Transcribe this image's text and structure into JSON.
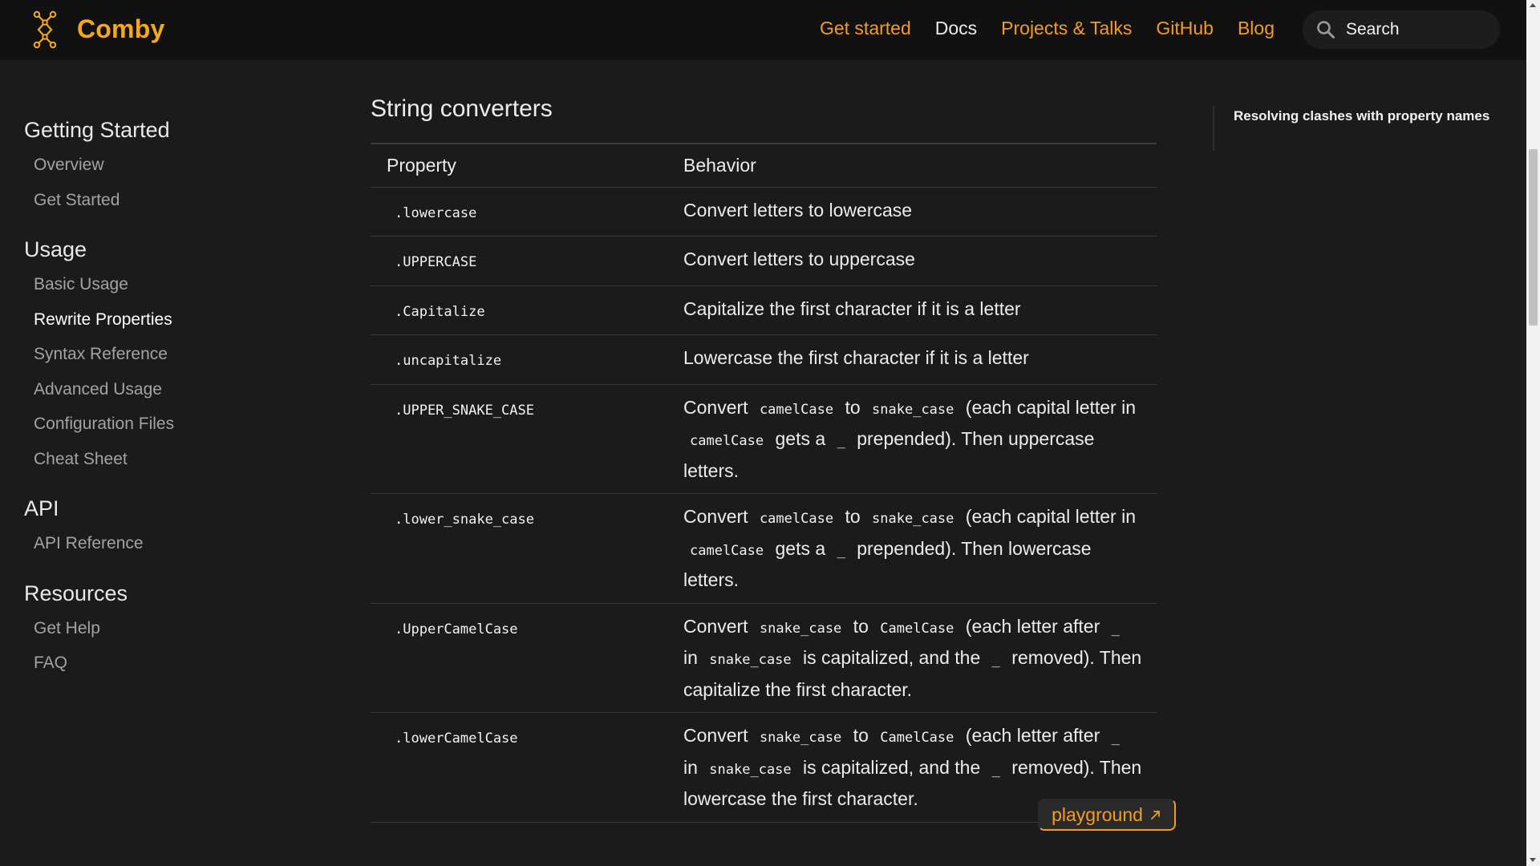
{
  "brand": {
    "name": "Comby",
    "logo_icon": "comby-logo-icon"
  },
  "nav": {
    "links": [
      {
        "label": "Get started",
        "color": "#f39c23"
      },
      {
        "label": "Docs",
        "color": "#ebebeb"
      },
      {
        "label": "Projects & Talks",
        "color": "#f39c23"
      },
      {
        "label": "GitHub",
        "color": "#f39c23"
      },
      {
        "label": "Blog",
        "color": "#f39c23"
      }
    ],
    "search": {
      "label": "Search",
      "icon": "search-icon"
    }
  },
  "sidebar": {
    "groups": [
      {
        "heading": "Getting Started",
        "items": [
          "Overview",
          "Get Started"
        ]
      },
      {
        "heading": "Usage",
        "items": [
          "Basic Usage",
          "Rewrite Properties",
          "Syntax Reference",
          "Advanced Usage",
          "Configuration Files",
          "Cheat Sheet"
        ]
      },
      {
        "heading": "API",
        "items": [
          "API Reference"
        ]
      },
      {
        "heading": "Resources",
        "items": [
          "Get Help",
          "FAQ"
        ]
      }
    ],
    "active_item": "Rewrite Properties"
  },
  "main": {
    "title": "String converters",
    "table": {
      "headers": [
        "Property",
        "Behavior"
      ],
      "rows": [
        {
          "property": ".lowercase",
          "behavior": [
            {
              "t": "Convert letters to lowercase"
            }
          ]
        },
        {
          "property": ".UPPERCASE",
          "behavior": [
            {
              "t": "Convert letters to uppercase"
            }
          ]
        },
        {
          "property": ".Capitalize",
          "behavior": [
            {
              "t": "Capitalize the first character if it is a letter"
            }
          ]
        },
        {
          "property": ".uncapitalize",
          "behavior": [
            {
              "t": "Lowercase the first character if it is a letter"
            }
          ]
        },
        {
          "property": ".UPPER_SNAKE_CASE",
          "behavior": [
            {
              "t": "Convert "
            },
            {
              "c": "camelCase"
            },
            {
              "t": " to "
            },
            {
              "c": "snake_case"
            },
            {
              "t": " (each capital letter in "
            },
            {
              "c": "camelCase"
            },
            {
              "t": " gets a "
            },
            {
              "c": "_"
            },
            {
              "t": " prepended). Then uppercase letters."
            }
          ]
        },
        {
          "property": ".lower_snake_case",
          "behavior": [
            {
              "t": "Convert "
            },
            {
              "c": "camelCase"
            },
            {
              "t": " to "
            },
            {
              "c": "snake_case"
            },
            {
              "t": " (each capital letter in "
            },
            {
              "c": "camelCase"
            },
            {
              "t": " gets a "
            },
            {
              "c": "_"
            },
            {
              "t": " prepended). Then lowercase letters."
            }
          ]
        },
        {
          "property": ".UpperCamelCase",
          "behavior": [
            {
              "t": "Convert "
            },
            {
              "c": "snake_case"
            },
            {
              "t": " to "
            },
            {
              "c": "CamelCase"
            },
            {
              "t": " (each letter after "
            },
            {
              "c": "_"
            },
            {
              "t": " in "
            },
            {
              "c": "snake_case"
            },
            {
              "t": " is capitalized, and the "
            },
            {
              "c": "_"
            },
            {
              "t": " removed). Then capitalize the first character."
            }
          ]
        },
        {
          "property": ".lowerCamelCase",
          "behavior": [
            {
              "t": "Convert "
            },
            {
              "c": "snake_case"
            },
            {
              "t": " to "
            },
            {
              "c": "CamelCase"
            },
            {
              "t": " (each letter after "
            },
            {
              "c": "_"
            },
            {
              "t": " in "
            },
            {
              "c": "snake_case"
            },
            {
              "t": " is capitalized, and the "
            },
            {
              "c": "_"
            },
            {
              "t": " removed). Then lowercase the first character."
            }
          ]
        }
      ]
    },
    "playground": {
      "label": "playground",
      "icon": "external-link-icon"
    }
  },
  "toc": {
    "items": [
      "Resolving clashes with property names"
    ]
  },
  "colors": {
    "accent": "#f39c23",
    "brand": "#f7a71b",
    "background": "#1b1b1b",
    "navbar": "#111111"
  }
}
